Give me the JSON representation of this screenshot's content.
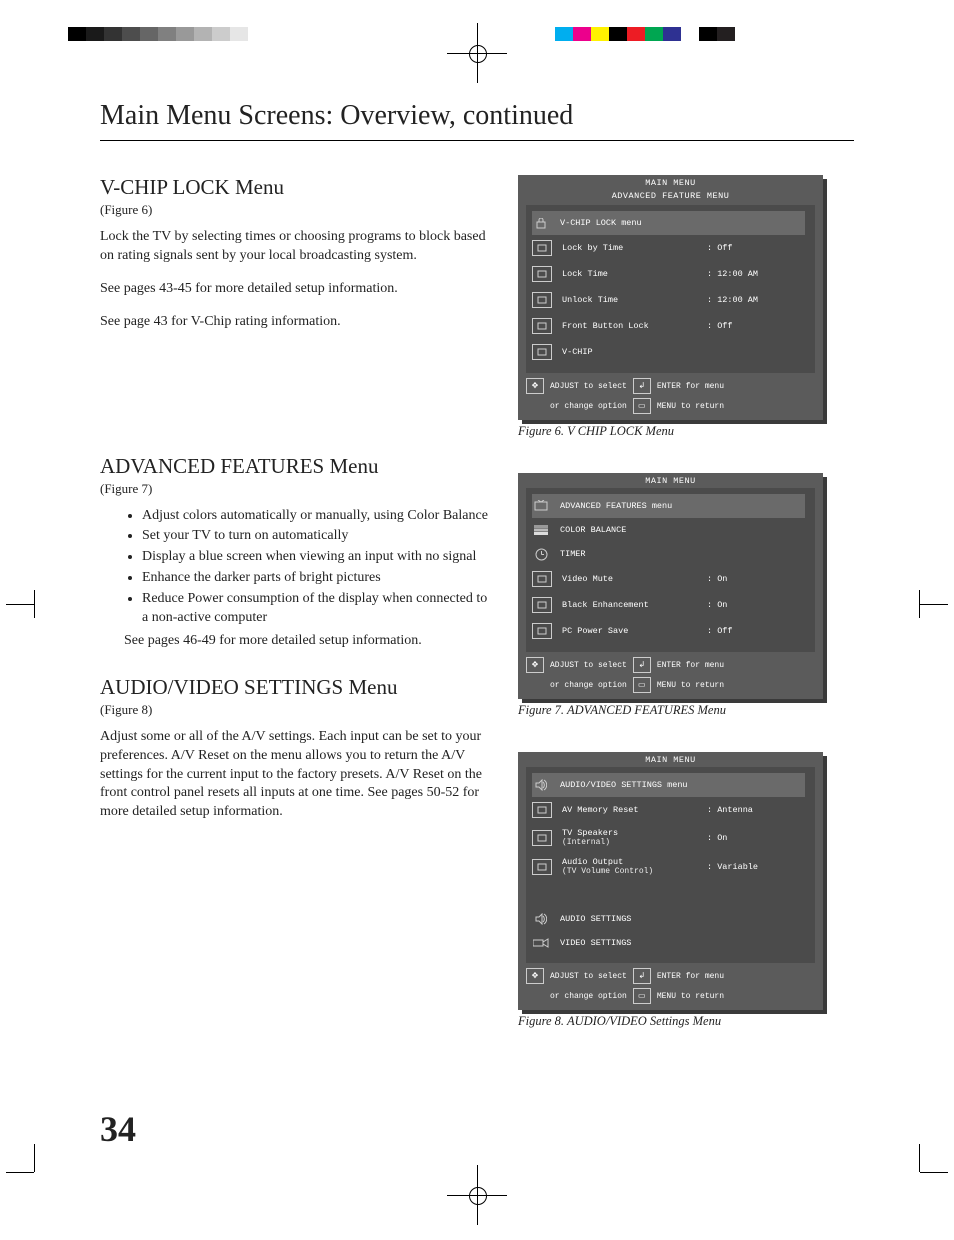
{
  "page_title": "Main Menu Screens: Overview, continued",
  "page_number": "34",
  "graybar_colors": [
    "#000000",
    "#1a1a1a",
    "#333333",
    "#4d4d4d",
    "#666666",
    "#808080",
    "#999999",
    "#b3b3b3",
    "#cccccc",
    "#e6e6e6"
  ],
  "colorbar_colors": [
    "#00aeef",
    "#ec008c",
    "#fff200",
    "#000000",
    "#ed1c24",
    "#00a651",
    "#2e3192",
    "#ffffff",
    "#000000",
    "#231f20"
  ],
  "sections": {
    "vchip": {
      "heading": "V-CHIP LOCK Menu",
      "fig_ref": "(Figure 6)",
      "p1": "Lock the TV by selecting times or choosing programs to block based on rating signals sent by your local broadcasting system.",
      "p2": "See pages 43-45 for more detailed setup information.",
      "p3": "See page 43 for V-Chip rating information.",
      "caption": "Figure 6.  V CHIP LOCK Menu"
    },
    "adv": {
      "heading": "ADVANCED FEATURES Menu",
      "fig_ref": "(Figure 7)",
      "bullets": [
        "Adjust colors automatically or manually, using Color Balance",
        "Set your TV to turn on automatically",
        "Display a blue screen when viewing an input with no signal",
        "Enhance the darker parts of bright pictures",
        "Reduce Power consumption of the display when connected to a non-active computer"
      ],
      "after": "See pages 46-49 for more detailed setup information.",
      "caption": "Figure 7.  ADVANCED FEATURES Menu"
    },
    "av": {
      "heading": "AUDIO/VIDEO SETTINGS Menu",
      "fig_ref": "(Figure 8)",
      "p1": "Adjust some or all of the A/V settings.  Each input can be set to your preferences.  A/V Reset on the menu allows you to return the A/V settings for the current input to the factory presets.  A/V Reset on the front control panel resets all inputs at one time.  See pages 50-52 for more detailed setup information.",
      "caption": "Figure 8.  AUDIO/VIDEO Settings Menu"
    }
  },
  "osd_hint": {
    "adjust": "ADJUST to select",
    "enter": "ENTER for menu",
    "change": "or change option",
    "menu": "MENU  to return"
  },
  "osd6": {
    "title1": "MAIN MENU",
    "title2": "ADVANCED FEATURE MENU",
    "rows": [
      {
        "icon": "lock",
        "label": "V-CHIP LOCK menu",
        "value": "",
        "hl": true
      },
      {
        "icon": "box",
        "label": "Lock by Time",
        "value": ": Off"
      },
      {
        "icon": "box",
        "label": "Lock Time",
        "value": ": 12:00 AM"
      },
      {
        "icon": "box",
        "label": "Unlock Time",
        "value": ": 12:00 AM"
      },
      {
        "icon": "box",
        "label": "Front Button Lock",
        "value": ": Off"
      },
      {
        "icon": "box",
        "label": "V-CHIP",
        "value": ""
      }
    ]
  },
  "osd7": {
    "title1": "MAIN MENU",
    "rows": [
      {
        "icon": "tv",
        "label": "ADVANCED FEATURES menu",
        "value": "",
        "hl": true
      },
      {
        "icon": "bars",
        "label": "COLOR BALANCE",
        "value": ""
      },
      {
        "icon": "clock",
        "label": "TIMER",
        "value": ""
      },
      {
        "icon": "box",
        "label": "Video Mute",
        "value": ": On"
      },
      {
        "icon": "box",
        "label": "Black Enhancement",
        "value": ": On"
      },
      {
        "icon": "box",
        "label": "PC Power Save",
        "value": ": Off"
      }
    ]
  },
  "osd8": {
    "title1": "MAIN MENU",
    "rows": [
      {
        "icon": "speaker",
        "label": "AUDIO/VIDEO SETTINGS menu",
        "value": "",
        "hl": true
      },
      {
        "icon": "box",
        "label": "AV Memory Reset",
        "value": ": Antenna"
      },
      {
        "icon": "box",
        "label": "TV Speakers",
        "label2": "(Internal)",
        "value": ": On"
      },
      {
        "icon": "box",
        "label": "Audio Output",
        "label2": "(TV Volume Control)",
        "value": ": Variable"
      },
      {
        "icon": "spacer",
        "label": "",
        "value": ""
      },
      {
        "icon": "speaker",
        "label": "AUDIO SETTINGS",
        "value": ""
      },
      {
        "icon": "video",
        "label": "VIDEO SETTINGS",
        "value": ""
      }
    ]
  }
}
